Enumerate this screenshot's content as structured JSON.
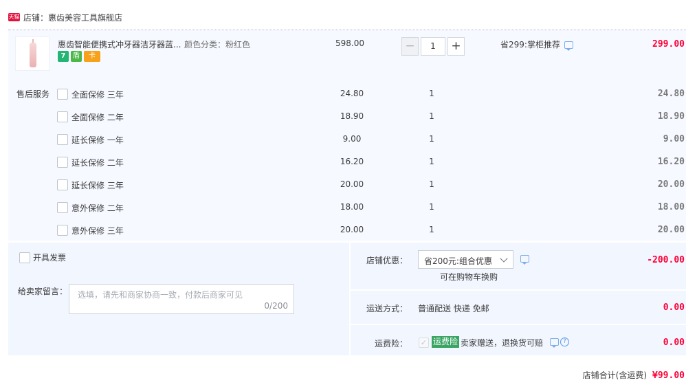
{
  "store": {
    "badge": "天猫",
    "name": "店铺：惠齿美容工具旗舰店"
  },
  "product": {
    "title": "惠齿智能便携式冲牙器洁牙器蓝...",
    "sku": "颜色分类：粉红色",
    "unit_price": "598.00",
    "quantity": "1",
    "qty_minus": "−",
    "qty_plus": "+",
    "promo": "省299:掌柜推荐",
    "line_total": "299.00",
    "badges": [
      "7",
      "盾",
      "卡"
    ]
  },
  "after_sales": {
    "label": "售后服务",
    "items": [
      {
        "name": "全面保修 三年",
        "price": "24.80",
        "qty": "1",
        "total": "24.80"
      },
      {
        "name": "全面保修 二年",
        "price": "18.90",
        "qty": "1",
        "total": "18.90"
      },
      {
        "name": "延长保修 一年",
        "price": "9.00",
        "qty": "1",
        "total": "9.00"
      },
      {
        "name": "延长保修 二年",
        "price": "16.20",
        "qty": "1",
        "total": "16.20"
      },
      {
        "name": "延长保修 三年",
        "price": "20.00",
        "qty": "1",
        "total": "20.00"
      },
      {
        "name": "意外保修 二年",
        "price": "18.00",
        "qty": "1",
        "total": "18.00"
      },
      {
        "name": "意外保修 三年",
        "price": "20.00",
        "qty": "1",
        "total": "20.00"
      }
    ]
  },
  "invoice": {
    "label": "开具发票"
  },
  "message": {
    "label": "给卖家留言：",
    "placeholder": "选填，请先和商家协商一致，付款后商家可见",
    "counter": "0/200"
  },
  "discount": {
    "label": "店铺优惠：",
    "selected": "省200元:组合优惠",
    "note": "可在购物车换购",
    "amount": "-200.00"
  },
  "shipping": {
    "label": "运送方式：",
    "method": "普通配送 快递 免邮",
    "amount": "0.00"
  },
  "insurance": {
    "label": "运费险：",
    "check": "✓",
    "tag": "运费险",
    "desc": "卖家赠送，退换货可赔",
    "help": "?",
    "amount": "0.00"
  },
  "summary": {
    "label": "店铺合计(含运费)",
    "value": "¥99.00"
  },
  "colors": {
    "price_red": "#ff0036",
    "panel_bg": "#f2f6ff",
    "accent_blue": "#5b9ae6",
    "insurance_green": "#3aa463"
  }
}
